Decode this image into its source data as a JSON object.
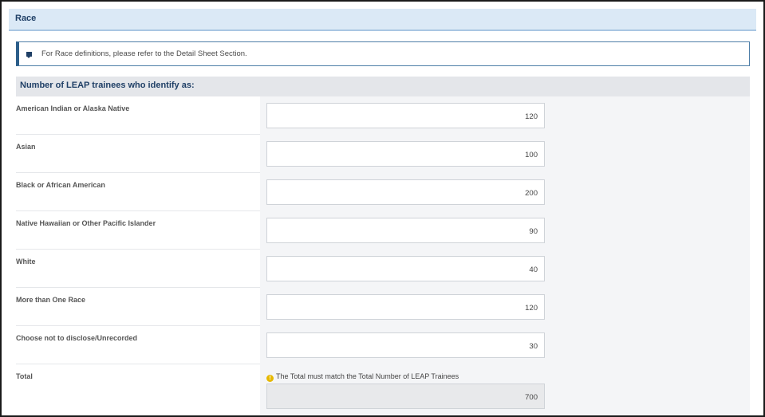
{
  "section": {
    "title": "Race"
  },
  "info": {
    "icon": "comment-icon",
    "text": "For Race definitions, please refer to the Detail Sheet Section."
  },
  "group": {
    "title": "Number of LEAP trainees who identify as:"
  },
  "rows": [
    {
      "label": "American Indian or Alaska Native",
      "value": "120"
    },
    {
      "label": "Asian",
      "value": "100"
    },
    {
      "label": "Black or African American",
      "value": "200"
    },
    {
      "label": "Native Hawaiian or Other Pacific Islander",
      "value": "90"
    },
    {
      "label": "White",
      "value": "40"
    },
    {
      "label": "More than One Race",
      "value": "120"
    },
    {
      "label": "Choose not to disclose/Unrecorded",
      "value": "30"
    }
  ],
  "total": {
    "label": "Total",
    "warning_icon": "warning-icon",
    "warning_text": "The Total must match the Total Number of LEAP Trainees",
    "value": "700"
  },
  "colors": {
    "header_bg": "#dbe9f6",
    "accent": "#1f3f66",
    "warning": "#e6b800"
  }
}
